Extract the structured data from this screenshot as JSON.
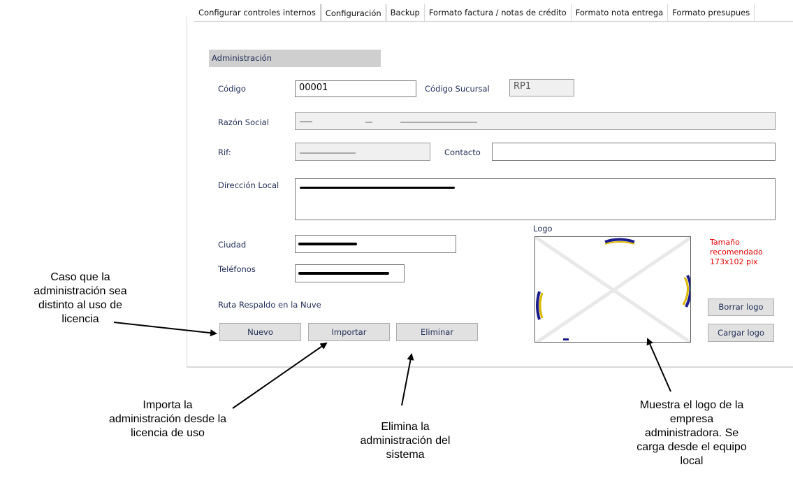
{
  "tabs": [
    {
      "label": "Configurar controles internos"
    },
    {
      "label": "Configuración"
    },
    {
      "label": "Backup"
    },
    {
      "label": "Formato factura / notas de crédito"
    },
    {
      "label": "Formato nota entrega"
    },
    {
      "label": "Formato presupues"
    }
  ],
  "section": {
    "title": "Administración"
  },
  "form": {
    "codigo_label": "Código",
    "codigo_value": "00001",
    "codigo_sucursal_label": "Código Sucursal",
    "codigo_sucursal_value": "RP1",
    "razon_social_label": "Razón Social",
    "rif_label": "Rif:",
    "contacto_label": "Contacto",
    "direccion_label": "Dirección Local",
    "ciudad_label": "Ciudad",
    "telefonos_label": "Teléfonos",
    "ruta_respaldo_label": "Ruta Respaldo en la Nuve"
  },
  "buttons": {
    "nuevo": "Nuevo",
    "importar": "Importar",
    "eliminar": "Eliminar",
    "borrar_logo": "Borrar logo",
    "cargar_logo": "Cargar logo"
  },
  "logo": {
    "label": "Logo",
    "hint_line1": "Tamaño",
    "hint_line2": "recomendado",
    "hint_line3": "173x102 pix",
    "hint_color": "#e00000"
  },
  "annotations": {
    "nuevo": [
      "Caso que la",
      "administración sea",
      "distinto al uso de",
      "licencia"
    ],
    "importar": [
      "Importa la",
      "administración desde la",
      "licencia de uso"
    ],
    "eliminar": [
      "Elimina la",
      "administración del",
      "sistema"
    ],
    "logo": [
      "Muestra el logo de la",
      "empresa",
      "administradora. Se",
      "carga desde el equipo",
      "local"
    ]
  }
}
